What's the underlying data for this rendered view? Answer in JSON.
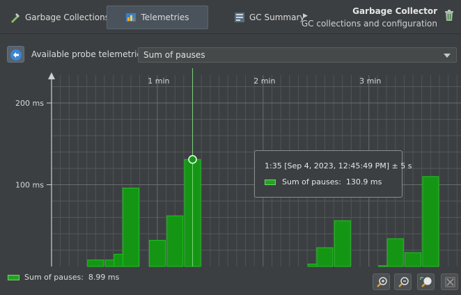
{
  "toolbar": {
    "tabs": [
      {
        "label": "Garbage Collections",
        "icon": "garbage-collections-icon"
      },
      {
        "label": "Telemetries",
        "icon": "telemetries-icon",
        "active": true
      },
      {
        "label": "GC Summary",
        "icon": "gc-summary-icon"
      }
    ],
    "title": "Garbage Collector",
    "subtitle": "GC collections and configuration"
  },
  "probe": {
    "label": "Available probe telemetries:",
    "selected": "Sum of pauses"
  },
  "tooltip": {
    "time": "1:35 [Sep 4, 2023, 12:45:49 PM] ± 5 s",
    "series_label": "Sum of pauses:",
    "value": "130.9 ms"
  },
  "legend": {
    "label": "Sum of pauses:",
    "value": "8.99 ms"
  },
  "zoom": [
    "zoom-in-icon",
    "zoom-out-icon",
    "zoom-fit-icon",
    "close-icon"
  ],
  "colors": {
    "background": "#3c3f41",
    "bar": "#149614",
    "bar_outline": "#22c022",
    "cursor": "#7ad67a"
  },
  "chart_data": {
    "type": "bar",
    "series": [
      {
        "name": "Sum of pauses",
        "points": [
          {
            "t": 25,
            "v": 8
          },
          {
            "t": 35,
            "v": 8
          },
          {
            "t": 40,
            "v": 15
          },
          {
            "t": 45,
            "v": 96
          },
          {
            "t": 60,
            "v": 32
          },
          {
            "t": 70,
            "v": 62
          },
          {
            "t": 80,
            "v": 130.9
          },
          {
            "t": 150,
            "v": 3
          },
          {
            "t": 155,
            "v": 23
          },
          {
            "t": 165,
            "v": 56
          },
          {
            "t": 190,
            "v": 1
          },
          {
            "t": 195,
            "v": 34
          },
          {
            "t": 205,
            "v": 17
          },
          {
            "t": 215,
            "v": 110
          }
        ]
      }
    ],
    "x_ticks": [
      {
        "t": 60,
        "label": "1 min"
      },
      {
        "t": 120,
        "label": "2 min"
      },
      {
        "t": 180,
        "label": "3 min"
      }
    ],
    "y_ticks": [
      {
        "v": 100,
        "label": "100 ms"
      },
      {
        "v": 200,
        "label": "200 ms"
      }
    ],
    "cursor_t": 80,
    "grid": true
  }
}
